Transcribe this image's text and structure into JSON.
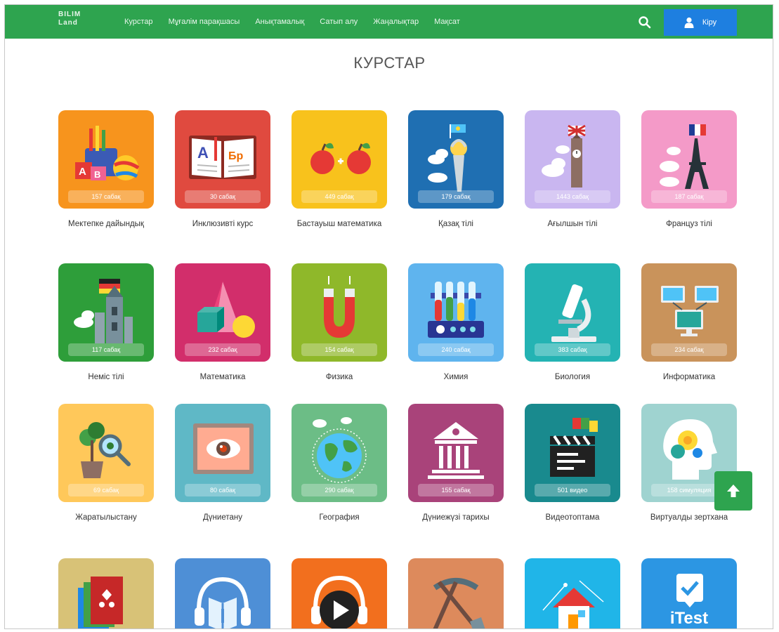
{
  "header": {
    "logo_line1": "BILIM",
    "logo_line2": "Land",
    "nav": [
      "Курстар",
      "Мұғалім парақшасы",
      "Анықтамалық",
      "Сатып алу",
      "Жаңалықтар",
      "Мақсат"
    ],
    "login_label": "Кіру"
  },
  "page": {
    "title": "КУРСТАР"
  },
  "courses": [
    {
      "name": "Мектепке дайындық",
      "count": "157 сабақ",
      "color": "#f7941d",
      "icon": "school-supplies-icon"
    },
    {
      "name": "Инклюзивті курс",
      "count": "30 сабақ",
      "color": "#e04a3f",
      "icon": "open-book-icon"
    },
    {
      "name": "Бастауыш математика",
      "count": "449 сабақ",
      "color": "#f8c21c",
      "icon": "apples-addition-icon"
    },
    {
      "name": "Қазақ тілі",
      "count": "179 сабақ",
      "color": "#1f6fb2",
      "icon": "baiterek-tower-icon"
    },
    {
      "name": "Ағылшын тілі",
      "count": "1443 сабақ",
      "color": "#c9b6f0",
      "icon": "big-ben-icon"
    },
    {
      "name": "Француз тілі",
      "count": "187 сабақ",
      "color": "#f49ac8",
      "icon": "eiffel-tower-icon"
    },
    {
      "name": "Неміс тілі",
      "count": "117 сабақ",
      "color": "#2e9e3a",
      "icon": "german-castle-icon"
    },
    {
      "name": "Математика",
      "count": "232 сабақ",
      "color": "#d22e6b",
      "icon": "geometric-shapes-icon"
    },
    {
      "name": "Физика",
      "count": "154 сабақ",
      "color": "#8fb82a",
      "icon": "magnet-icon"
    },
    {
      "name": "Химия",
      "count": "240 сабақ",
      "color": "#5fb4ee",
      "icon": "test-tubes-icon"
    },
    {
      "name": "Биология",
      "count": "383 сабақ",
      "color": "#24b3b3",
      "icon": "microscope-icon"
    },
    {
      "name": "Информатика",
      "count": "234 сабақ",
      "color": "#c9935b",
      "icon": "computers-icon"
    },
    {
      "name": "Жаратылыстану",
      "count": "69 сабақ",
      "color": "#ffc85a",
      "icon": "plant-magnifier-icon"
    },
    {
      "name": "Дүниетану",
      "count": "80 сабақ",
      "color": "#5fb8c6",
      "icon": "eye-book-icon"
    },
    {
      "name": "География",
      "count": "290 сабақ",
      "color": "#6cbd86",
      "icon": "globe-icon"
    },
    {
      "name": "Дүниежүзі тарихы",
      "count": "155 сабақ",
      "color": "#a9437a",
      "icon": "ancient-temple-icon"
    },
    {
      "name": "Видеотоптама",
      "count": "501 видео",
      "color": "#198a8e",
      "icon": "clapperboard-icon"
    },
    {
      "name": "Виртуалды зертхана",
      "count": "158 симуляция",
      "color": "#9fd3d0",
      "icon": "head-gears-icon"
    },
    {
      "name": "",
      "count": "",
      "color": "#d8c277",
      "icon": "books-ornament-icon"
    },
    {
      "name": "",
      "count": "",
      "color": "#4e8fd6",
      "icon": "audio-book-icon"
    },
    {
      "name": "",
      "count": "",
      "color": "#f26f1e",
      "icon": "audio-play-icon"
    },
    {
      "name": "",
      "count": "",
      "color": "#dd8a5c",
      "icon": "pickaxe-shovel-icon"
    },
    {
      "name": "",
      "count": "",
      "color": "#20b5e8",
      "icon": "house-icon"
    },
    {
      "name": "",
      "count": "",
      "color": "#2c96e3",
      "icon": "itest-icon",
      "label": "iTest"
    }
  ],
  "colors": {
    "navbar": "#2ea44f",
    "login": "#1e7fe0",
    "scroll_top": "#2ea44f"
  }
}
